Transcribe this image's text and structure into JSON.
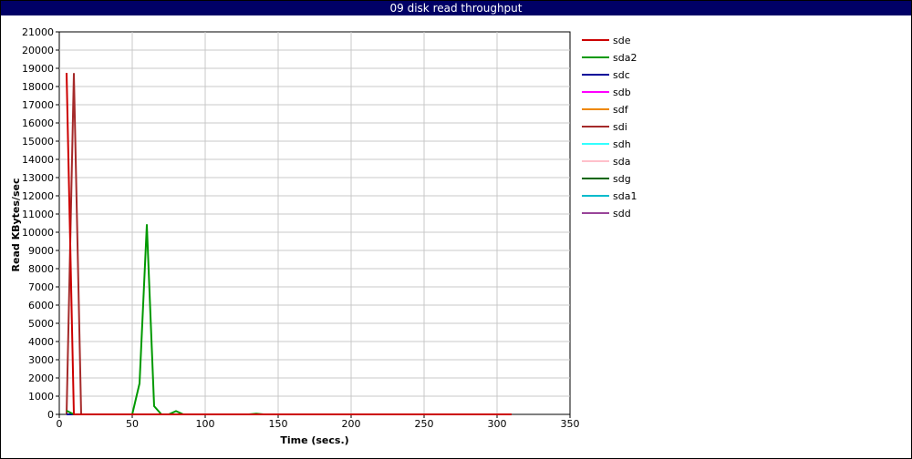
{
  "window": {
    "title": "09 disk read throughput"
  },
  "chart_data": {
    "type": "line",
    "title": "09 disk read throughput",
    "xlabel": "Time (secs.)",
    "ylabel": "Read KBytes/sec",
    "xlim": [
      0,
      350
    ],
    "ylim": [
      0,
      21000
    ],
    "xticks": [
      0,
      50,
      100,
      150,
      200,
      250,
      300,
      350
    ],
    "yticks": [
      0,
      1000,
      2000,
      3000,
      4000,
      5000,
      6000,
      7000,
      8000,
      9000,
      10000,
      11000,
      12000,
      13000,
      14000,
      15000,
      16000,
      17000,
      18000,
      19000,
      20000,
      21000
    ],
    "grid": true,
    "legend_position": "right",
    "series": [
      {
        "name": "sde",
        "color": "#cc0000",
        "x": [
          5,
          10,
          15,
          20,
          310
        ],
        "y": [
          18750,
          0,
          0,
          0,
          0
        ]
      },
      {
        "name": "sda2",
        "color": "#009900",
        "x": [
          5,
          10,
          15,
          50,
          55,
          60,
          65,
          70,
          75,
          80,
          85,
          90,
          130,
          135,
          140,
          150,
          200,
          310
        ],
        "y": [
          200,
          0,
          0,
          0,
          1700,
          10400,
          450,
          0,
          0,
          180,
          0,
          0,
          0,
          40,
          0,
          0,
          0,
          0
        ]
      },
      {
        "name": "sdc",
        "color": "#000099",
        "x": [
          5,
          310
        ],
        "y": [
          0,
          0
        ]
      },
      {
        "name": "sdb",
        "color": "#ff00ff",
        "x": [
          5,
          310
        ],
        "y": [
          0,
          0
        ]
      },
      {
        "name": "sdf",
        "color": "#ee8800",
        "x": [
          5,
          310
        ],
        "y": [
          0,
          0
        ]
      },
      {
        "name": "sdi",
        "color": "#a52a2a",
        "x": [
          5,
          10,
          15,
          20,
          310
        ],
        "y": [
          0,
          18700,
          0,
          0,
          0
        ]
      },
      {
        "name": "sdh",
        "color": "#33ffff",
        "x": [
          5,
          310
        ],
        "y": [
          0,
          0
        ]
      },
      {
        "name": "sda",
        "color": "#ffc0cb",
        "x": [
          5,
          310
        ],
        "y": [
          0,
          0
        ]
      },
      {
        "name": "sdg",
        "color": "#006600",
        "x": [
          5,
          310
        ],
        "y": [
          0,
          0
        ]
      },
      {
        "name": "sda1",
        "color": "#00bbcc",
        "x": [
          5,
          310
        ],
        "y": [
          0,
          0
        ]
      },
      {
        "name": "sdd",
        "color": "#994499",
        "x": [
          5,
          310
        ],
        "y": [
          0,
          0
        ]
      }
    ]
  }
}
